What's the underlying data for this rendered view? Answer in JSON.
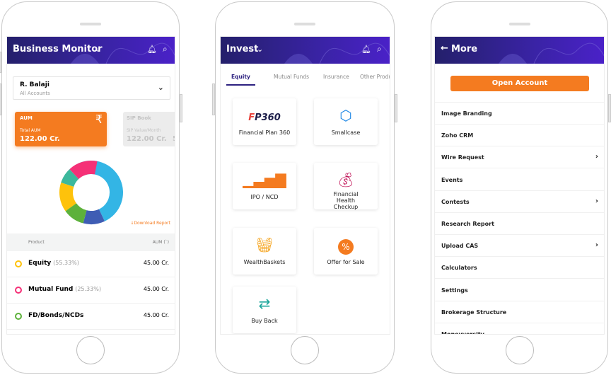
{
  "business_monitor": {
    "title": "Business Monitor",
    "client_name": "R. Balaji",
    "client_sub": "All Accounts",
    "aum_card": {
      "title": "AUM",
      "label": "Total AUM",
      "value": "122.00 Cr.",
      "icon": "rupee-icon",
      "color": "#f47b20"
    },
    "sip_card": {
      "title": "SIP Book",
      "label": "SIP Value/Month",
      "value": "122.00 Cr.",
      "cut_value": "5"
    },
    "donut_segments": [
      {
        "color": "#33b5e5",
        "share": 0.5
      },
      {
        "color": "#3f5db4",
        "share": 0.11
      },
      {
        "color": "#5db13b",
        "share": 0.11
      },
      {
        "color": "#fec20b",
        "share": 0.15
      },
      {
        "color": "#3cb89c",
        "share": 0.08
      },
      {
        "color": "#f53077",
        "share": 0.15
      }
    ],
    "download_label": "Download Report",
    "table_headers": [
      "Product",
      "AUM (`)"
    ],
    "rows": [
      {
        "name": "Equity",
        "pct": "(55.33%)",
        "value": "45.00 Cr.",
        "color": "#fec20b"
      },
      {
        "name": "Mutual Fund",
        "pct": "(25.33%)",
        "value": "45.00 Cr.",
        "color": "#f53077"
      },
      {
        "name": "FD/Bonds/NCDs",
        "pct": "",
        "value": "45.00 Cr.",
        "color": "#5db13b"
      }
    ]
  },
  "invest": {
    "title": "Invest",
    "tabs": [
      "Equity",
      "Mutual Funds",
      "Insurance",
      "Other Product"
    ],
    "active_tab": "Equity",
    "logo_text": "FP360",
    "cards": [
      {
        "label": "Financial Plan 360",
        "icon": "fp360-logo"
      },
      {
        "label": "Smallcase",
        "icon": "smallcase-icon"
      },
      {
        "label": "IPO / NCD",
        "icon": "bar-chart-icon"
      },
      {
        "label": "Financial Health Checkup",
        "icon": "money-bag-icon"
      },
      {
        "label": "WealthBaskets",
        "icon": "basket-icon"
      },
      {
        "label": "Offer for Sale",
        "icon": "percent-badge-icon"
      },
      {
        "label": "Buy Back",
        "icon": "rupee-exchange-icon"
      }
    ]
  },
  "more": {
    "title": "More",
    "open_account": "Open Account",
    "items": [
      {
        "label": "Image Branding",
        "chevron": false
      },
      {
        "label": "Zoho CRM",
        "chevron": false
      },
      {
        "label": "Wire Request",
        "chevron": true
      },
      {
        "label": "Events",
        "chevron": false
      },
      {
        "label": "Contests",
        "chevron": true
      },
      {
        "label": "Research Report",
        "chevron": false
      },
      {
        "label": "Upload CAS",
        "chevron": true
      },
      {
        "label": "Calculators",
        "chevron": false
      },
      {
        "label": "Settings",
        "chevron": false
      },
      {
        "label": "Brokerage Structure",
        "chevron": false
      },
      {
        "label": "Moneyversity",
        "chevron": false
      }
    ]
  },
  "colors": {
    "header": "#3a23a6",
    "accent": "#f47b20",
    "tab_active": "#2d2180"
  }
}
